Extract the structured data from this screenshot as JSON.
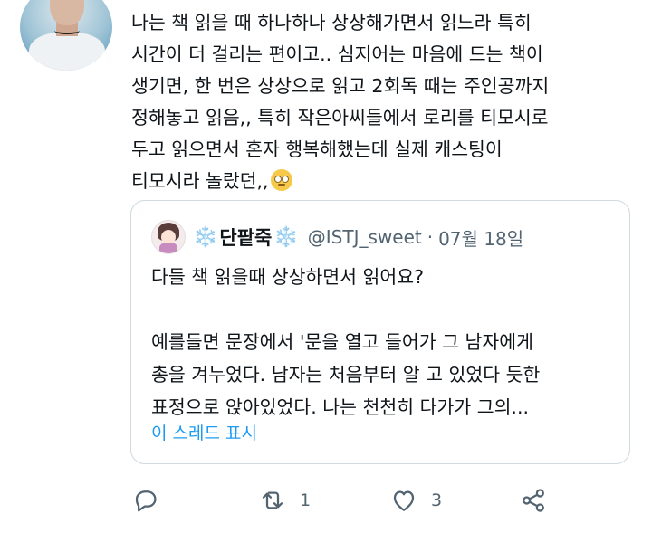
{
  "tweet": {
    "lines": [
      "나는 책 읽을 때 하나하나 상상해가면서 읽느라 특히",
      "시간이 더 걸리는 편이고.. 심지어는 마음에 드는 책이",
      "생기면, 한 번은 상상으로 읽고 2회독 때는 주인공까지",
      "정해놓고 읽음,, 특히 작은아씨들에서 로리를 티모시로",
      "두고 읽으면서 혼자 행복해했는데 실제 캐스팅이",
      "티모시라 놀랐던,,"
    ],
    "emoji": "face-with-rolling-eyes-emoji"
  },
  "quote": {
    "snowflake_left": "❄️",
    "name": "단팥죽",
    "snowflake_right": "❄️",
    "handle": "@ISTJ_sweet",
    "separator": "·",
    "date": "07월 18일",
    "line1": "다들 책 읽을때 상상하면서 읽어요?",
    "line2": "",
    "line3": "예를들면 문장에서 '문을 열고 들어가 그 남자에게",
    "line4": "총을 겨누었다. 남자는 처음부터 알 고 있었다 듯한",
    "line5": "표정으로 앉아있었다. 나는 천천히 다가가 그의...",
    "show_thread": "이 스레드 표시"
  },
  "actions": {
    "reply_count": "",
    "retweet_count": "1",
    "like_count": "3"
  },
  "colors": {
    "accent": "#1d9bf0",
    "secondary_text": "#536471",
    "border": "#cfd9de"
  }
}
